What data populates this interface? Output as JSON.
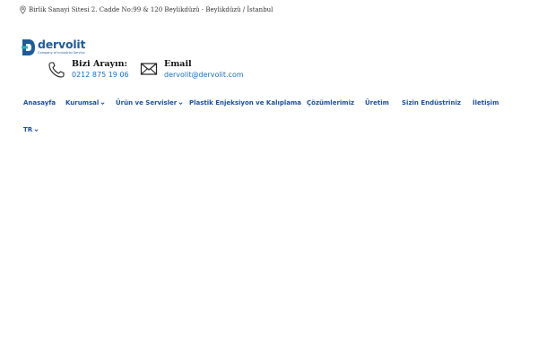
{
  "topbar": {
    "address": "Birlik Sanayi Sitesi 2. Cadde No:99 & 120 Beylikdüzü - Beylikdüzü / İstanbul",
    "icon": "map-pin-icon"
  },
  "brand": {
    "name": "dervolit",
    "tagline": "Company of Industrial Service",
    "color": "#1f5b9c"
  },
  "contacts": {
    "call": {
      "heading": "Bizi Arayın:",
      "value": "0212 875 19 06",
      "icon": "phone-icon"
    },
    "email": {
      "heading": "Email",
      "value": "dervolit@dervolit.com",
      "icon": "envelope-icon"
    }
  },
  "nav": {
    "items": [
      {
        "label": "Anasayfa"
      },
      {
        "label": "Kurumsal"
      },
      {
        "label": "Ürün ve Servisler"
      },
      {
        "label": "Plastik Enjeksiyon ve Kalıplama"
      },
      {
        "label": "Çözümlerimiz"
      },
      {
        "label": "Üretim"
      },
      {
        "label": "Sizin Endüstriniz"
      },
      {
        "label": "İletişim"
      }
    ],
    "language": "TR",
    "link_color": "#1a4f9a"
  }
}
